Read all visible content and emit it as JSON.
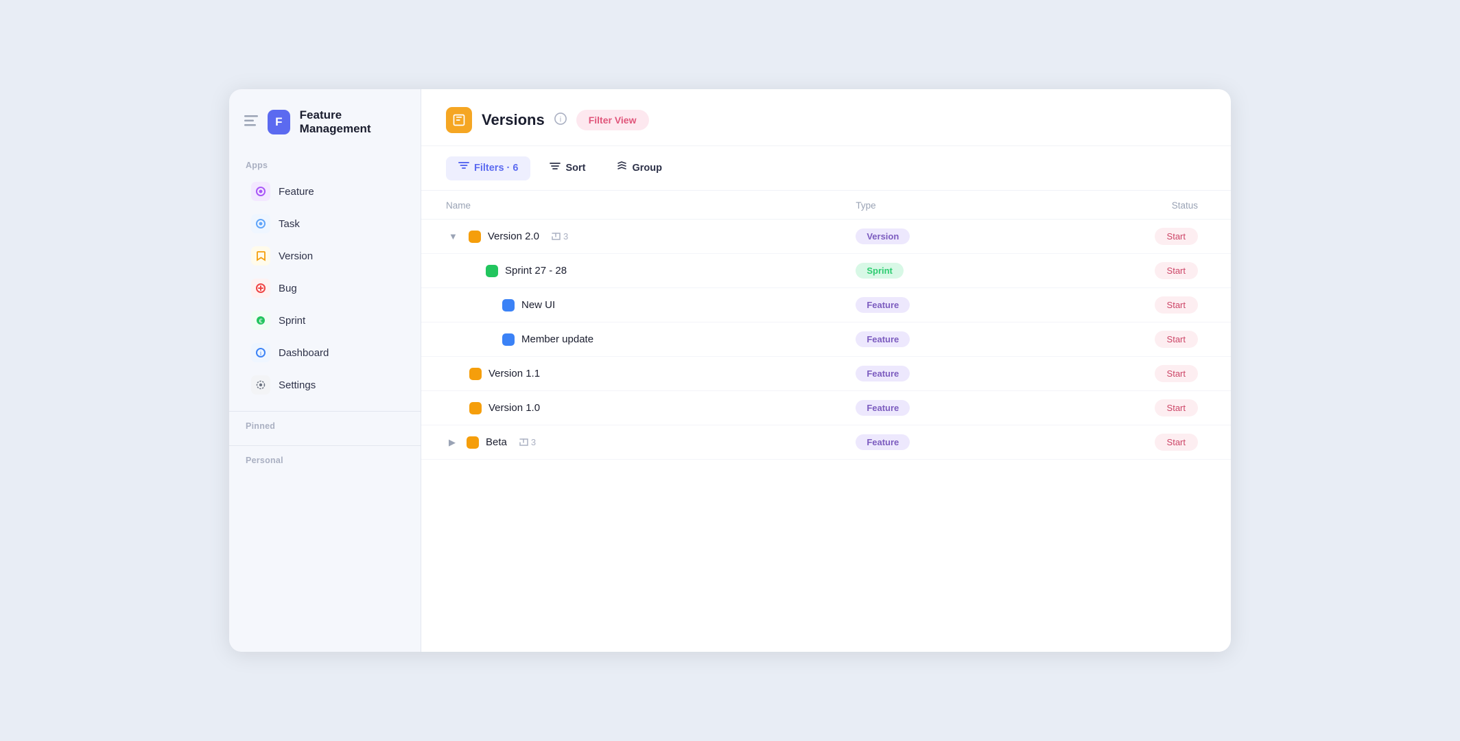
{
  "sidebar": {
    "menu_icon": "☰",
    "logo_letter": "F",
    "title": "Feature Management",
    "apps_label": "Apps",
    "items": [
      {
        "id": "feature",
        "label": "Feature",
        "icon_color": "#a855f7",
        "icon_bg": "#f3e8ff",
        "icon": "◎"
      },
      {
        "id": "task",
        "label": "Task",
        "icon_color": "#60a5fa",
        "icon_bg": "#eff6ff",
        "icon": "◎"
      },
      {
        "id": "version",
        "label": "Version",
        "icon_color": "#f59e0b",
        "icon_bg": "#fffbeb",
        "icon": "🔖"
      },
      {
        "id": "bug",
        "label": "Bug",
        "icon_color": "#ef4444",
        "icon_bg": "#fef2f2",
        "icon": "⊕"
      },
      {
        "id": "sprint",
        "label": "Sprint",
        "icon_color": "#22c55e",
        "icon_bg": "#f0fdf4",
        "icon": "€"
      },
      {
        "id": "dashboard",
        "label": "Dashboard",
        "icon_color": "#3b82f6",
        "icon_bg": "#eff6ff",
        "icon": "ℹ"
      },
      {
        "id": "settings",
        "label": "Settings",
        "icon_color": "#6b7280",
        "icon_bg": "#f3f4f6",
        "icon": "⚙"
      }
    ],
    "pinned_label": "Pinned",
    "personal_label": "Personal"
  },
  "main": {
    "header": {
      "icon": "🔖",
      "icon_bg": "#f5a623",
      "title": "Versions",
      "info_tooltip": "ℹ",
      "filter_view_label": "Filter View"
    },
    "toolbar": {
      "filters_label": "Filters · 6",
      "sort_label": "Sort",
      "group_label": "Group"
    },
    "table": {
      "columns": [
        "Name",
        "Type",
        "Status"
      ],
      "rows": [
        {
          "id": "v2",
          "name": "Version 2.0",
          "indent": 0,
          "expandable": true,
          "expanded": true,
          "icon_color": "#f59e0b",
          "icon_type": "square",
          "child_count": 3,
          "type_label": "Version",
          "type_badge": "badge-version",
          "status_label": "Start"
        },
        {
          "id": "sprint27",
          "name": "Sprint 27 - 28",
          "indent": 1,
          "expandable": false,
          "expanded": false,
          "icon_color": "#22c55e",
          "icon_type": "square",
          "child_count": 0,
          "type_label": "Sprint",
          "type_badge": "badge-sprint",
          "status_label": "Start"
        },
        {
          "id": "newui",
          "name": "New UI",
          "indent": 2,
          "expandable": false,
          "expanded": false,
          "icon_color": "#3b82f6",
          "icon_type": "square",
          "child_count": 0,
          "type_label": "Feature",
          "type_badge": "badge-feature",
          "status_label": "Start"
        },
        {
          "id": "memberupdate",
          "name": "Member update",
          "indent": 2,
          "expandable": false,
          "expanded": false,
          "icon_color": "#3b82f6",
          "icon_type": "square",
          "child_count": 0,
          "type_label": "Feature",
          "type_badge": "badge-feature",
          "status_label": "Start"
        },
        {
          "id": "v1.1",
          "name": "Version 1.1",
          "indent": 0,
          "expandable": false,
          "expanded": false,
          "icon_color": "#f59e0b",
          "icon_type": "square",
          "child_count": 0,
          "type_label": "Feature",
          "type_badge": "badge-feature",
          "status_label": "Start"
        },
        {
          "id": "v1.0",
          "name": "Version 1.0",
          "indent": 0,
          "expandable": false,
          "expanded": false,
          "icon_color": "#f59e0b",
          "icon_type": "square",
          "child_count": 0,
          "type_label": "Feature",
          "type_badge": "badge-feature",
          "status_label": "Start"
        },
        {
          "id": "beta",
          "name": "Beta",
          "indent": 0,
          "expandable": true,
          "expanded": false,
          "icon_color": "#f59e0b",
          "icon_type": "square",
          "child_count": 3,
          "type_label": "Feature",
          "type_badge": "badge-feature",
          "status_label": "Start"
        }
      ]
    }
  }
}
